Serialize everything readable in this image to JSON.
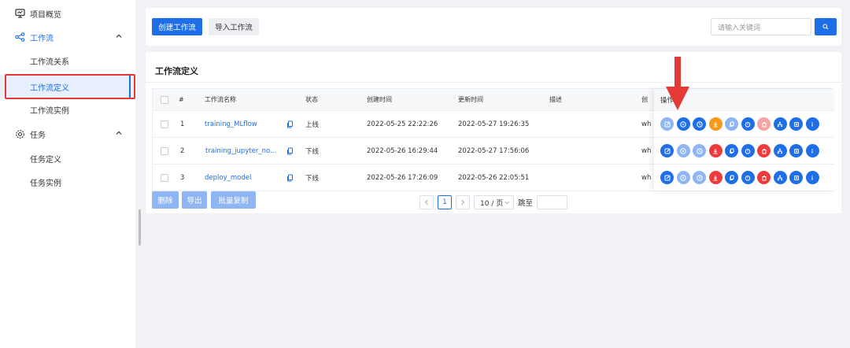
{
  "sidebar": {
    "items": [
      {
        "label": "项目概览"
      },
      {
        "label": "工作流"
      },
      {
        "label": "工作流关系"
      },
      {
        "label": "工作流定义"
      },
      {
        "label": "工作流实例"
      },
      {
        "label": "任务"
      },
      {
        "label": "任务定义"
      },
      {
        "label": "任务实例"
      }
    ]
  },
  "toolbar": {
    "create_label": "创建工作流",
    "import_label": "导入工作流",
    "search_placeholder": "请输入关键词"
  },
  "card": {
    "title": "工作流定义"
  },
  "table": {
    "columns": [
      "#",
      "工作流名称",
      "状态",
      "创建时间",
      "更新时间",
      "描述",
      "创",
      "操作"
    ],
    "rows": [
      {
        "index": "1",
        "name": "training_MLflow",
        "status": "上线",
        "created": "2022-05-25 22:22:26",
        "updated": "2022-05-27 19:26:35",
        "desc": "",
        "creator": "wh"
      },
      {
        "index": "2",
        "name": "training_jupyter_no...",
        "status": "下线",
        "created": "2022-05-26 16:29:44",
        "updated": "2022-05-27 17:56:06",
        "desc": "",
        "creator": "wh"
      },
      {
        "index": "3",
        "name": "deploy_model",
        "status": "下线",
        "created": "2022-05-26 17:26:09",
        "updated": "2022-05-26 22:05:51",
        "desc": "",
        "creator": "wh"
      }
    ],
    "ops_colors": [
      [
        "#8fb6f3",
        "#1e6ee8",
        "#1e6ee8",
        "#f59a1b",
        "#8fb6f3",
        "#1e6ee8",
        "#f5a3a3",
        "#1e6ee8",
        "#1e6ee8",
        "#1e6ee8"
      ],
      [
        "#1e6ee8",
        "#8fb6f3",
        "#8fb6f3",
        "#ee3a3a",
        "#1e6ee8",
        "#1e6ee8",
        "#ee3a3a",
        "#1e6ee8",
        "#1e6ee8",
        "#1e6ee8"
      ],
      [
        "#1e6ee8",
        "#8fb6f3",
        "#8fb6f3",
        "#ee3a3a",
        "#1e6ee8",
        "#1e6ee8",
        "#ee3a3a",
        "#1e6ee8",
        "#1e6ee8",
        "#1e6ee8"
      ]
    ]
  },
  "footer": {
    "delete_label": "删除",
    "export_label": "导出",
    "batch_copy_label": "批量复制",
    "current_page": "1",
    "page_size": "10 / 页",
    "jump_label": "跳至"
  },
  "colors": {
    "accent": "#1e6ee8",
    "danger": "#ee3a3a",
    "warning": "#f59a1b",
    "annotation": "#e53935"
  }
}
